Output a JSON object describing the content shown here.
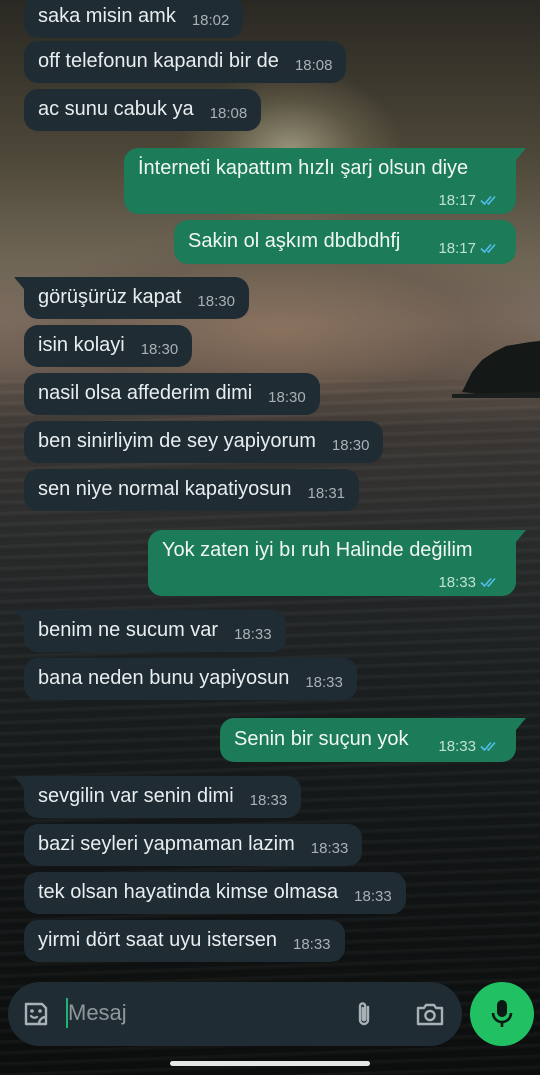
{
  "messages": [
    {
      "dir": "in",
      "text": "saka misin amk",
      "time": "18:02"
    },
    {
      "dir": "in",
      "text": "off telefonun kapandi bir de",
      "time": "18:08"
    },
    {
      "dir": "in",
      "text": "ac sunu cabuk ya",
      "time": "18:08"
    },
    {
      "dir": "out",
      "text": "İnterneti kapattım hızlı şarj olsun diye",
      "time": "18:17",
      "status": "read"
    },
    {
      "dir": "out",
      "text": "Sakin ol aşkım dbdbdhfj",
      "time": "18:17",
      "status": "read"
    },
    {
      "dir": "in",
      "text": "görüşürüz kapat",
      "time": "18:30"
    },
    {
      "dir": "in",
      "text": "isin kolayi",
      "time": "18:30"
    },
    {
      "dir": "in",
      "text": "nasil olsa affederim dimi",
      "time": "18:30"
    },
    {
      "dir": "in",
      "text": "ben sinirliyim de sey yapiyorum",
      "time": "18:30"
    },
    {
      "dir": "in",
      "text": "sen niye normal kapatiyosun",
      "time": "18:31"
    },
    {
      "dir": "out",
      "text": "Yok zaten iyi bı ruh Halinde değilim",
      "time": "18:33",
      "status": "read"
    },
    {
      "dir": "in",
      "text": "benim ne sucum var",
      "time": "18:33"
    },
    {
      "dir": "in",
      "text": "bana neden bunu yapiyosun",
      "time": "18:33"
    },
    {
      "dir": "out",
      "text": "Senin bir suçun yok",
      "time": "18:33",
      "status": "read"
    },
    {
      "dir": "in",
      "text": "sevgilin var senin dimi",
      "time": "18:33"
    },
    {
      "dir": "in",
      "text": "bazi seyleri yapmaman lazim",
      "time": "18:33"
    },
    {
      "dir": "in",
      "text": "tek olsan hayatinda kimse olmasa",
      "time": "18:33"
    },
    {
      "dir": "in",
      "text": "yirmi dört saat uyu istersen",
      "time": "18:33"
    }
  ],
  "composer": {
    "placeholder": "Mesaj",
    "value": ""
  },
  "icons": {
    "emoji": "sticker-smiley-icon",
    "attach": "paperclip-icon",
    "camera": "camera-icon",
    "mic": "microphone-icon",
    "read_receipt": "double-check-icon"
  },
  "colors": {
    "incoming_bubble": "#1f2c34",
    "outgoing_bubble": "#1c7c59",
    "accent_green": "#21c063",
    "read_tick": "#53bdeb"
  }
}
